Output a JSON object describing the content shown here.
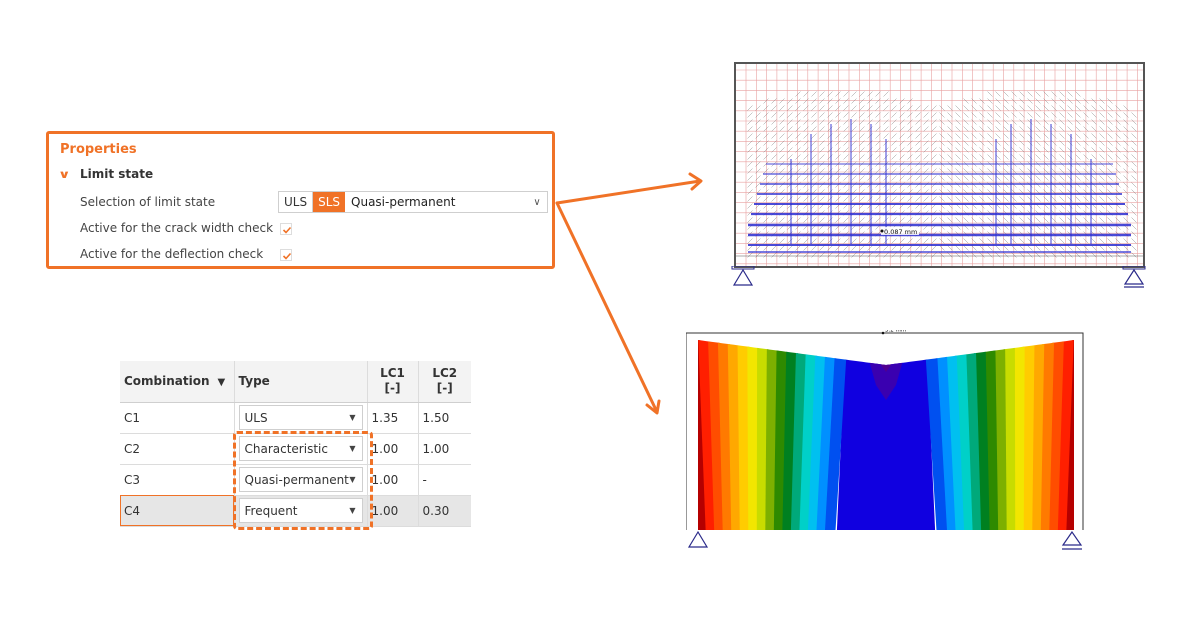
{
  "properties": {
    "title": "Properties",
    "group_label": "Limit state",
    "rows": [
      {
        "label": "Selection of limit state"
      },
      {
        "label": "Active for the crack width check",
        "checked": true
      },
      {
        "label": "Active for the deflection check",
        "checked": true
      }
    ],
    "limit_state": {
      "options": [
        "ULS",
        "SLS"
      ],
      "active": "SLS",
      "selected_value": "Quasi-permanent"
    }
  },
  "table": {
    "headers": {
      "combination": "Combination",
      "type": "Type",
      "lc1": "LC1",
      "lc1_unit": "[-]",
      "lc2": "LC2",
      "lc2_unit": "[-]"
    },
    "rows": [
      {
        "name": "C1",
        "type": "ULS",
        "lc1": "1.35",
        "lc2": "1.50"
      },
      {
        "name": "C2",
        "type": "Characteristic",
        "lc1": "1.00",
        "lc2": "1.00"
      },
      {
        "name": "C3",
        "type": "Quasi-permanent",
        "lc1": "1.00",
        "lc2": "-"
      },
      {
        "name": "C4",
        "type": "Frequent",
        "lc1": "1.00",
        "lc2": "0.30",
        "selected": true
      }
    ]
  },
  "crack_view": {
    "label": "0.087 mm"
  },
  "deflection_view": {
    "label": "3.2 mm"
  },
  "colors": {
    "accent": "#f07227",
    "mesh": "#e8a0a0",
    "reinforcement": "#2a2ad0"
  }
}
